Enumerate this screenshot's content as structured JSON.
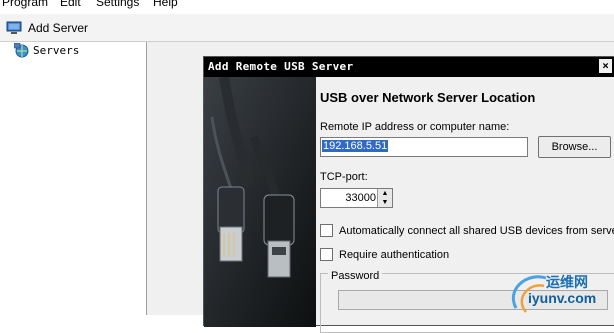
{
  "menu": {
    "items": [
      "Program",
      "Edit",
      "Settings",
      "Help"
    ]
  },
  "toolbar": {
    "add_server_label": "Add Server",
    "icon": "computer-icon"
  },
  "tree": {
    "root_label": "Servers",
    "icon": "globe-network-icon"
  },
  "dialog": {
    "title": "Add Remote USB Server",
    "close_label": "×",
    "heading": "USB over Network Server Location",
    "ip_label": "Remote IP address or computer name:",
    "ip_value": "192.168.5.51",
    "browse_label": "Browse...",
    "port_label": "TCP-port:",
    "port_value": "33000",
    "auto_connect_label": "Automatically connect all shared USB devices from server",
    "auto_connect_checked": false,
    "require_auth_label": "Require authentication",
    "require_auth_checked": false,
    "password_label": "Password",
    "password_value": "",
    "side_image": "usb-cable-image"
  },
  "watermark": {
    "cn": "运维网",
    "url": "iyunv.com"
  },
  "colors": {
    "titlebar": "#000000",
    "selection": "#316ac5",
    "dialog_bg": "#f0f0f0"
  }
}
